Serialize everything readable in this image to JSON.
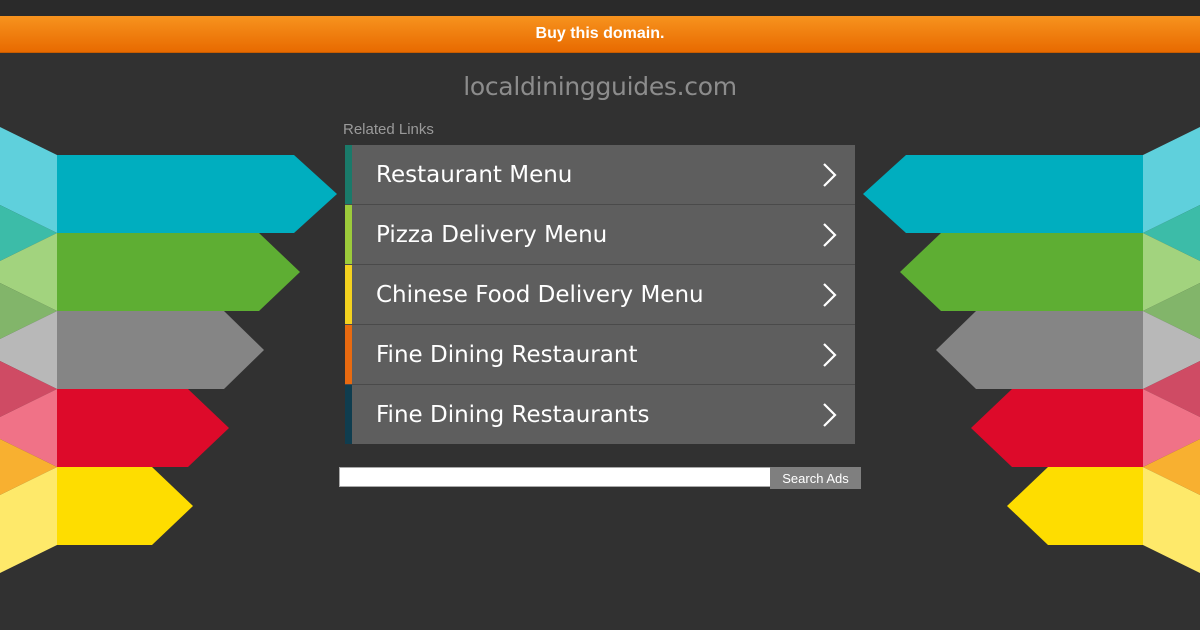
{
  "banner": {
    "label": "Buy this domain."
  },
  "site": {
    "domain": "localdiningguides.com"
  },
  "related": {
    "heading": "Related Links",
    "links": [
      {
        "label": "Restaurant Menu",
        "accent": "#1a7a6a"
      },
      {
        "label": "Pizza Delivery Menu",
        "accent": "#9ccb3b"
      },
      {
        "label": "Chinese Food Delivery Menu",
        "accent": "#f4d21f"
      },
      {
        "label": "Fine Dining Restaurant",
        "accent": "#e86a10"
      },
      {
        "label": "Fine Dining Restaurants",
        "accent": "#0f3d4f"
      }
    ]
  },
  "search": {
    "value": "",
    "button_label": "Search Ads"
  },
  "colors": {
    "background": "#313131",
    "banner": "#f7931e",
    "teal": "#00aebf",
    "green": "#5eae33",
    "gray": "#858585",
    "red": "#dd0a2a",
    "yellow": "#fedd00"
  }
}
